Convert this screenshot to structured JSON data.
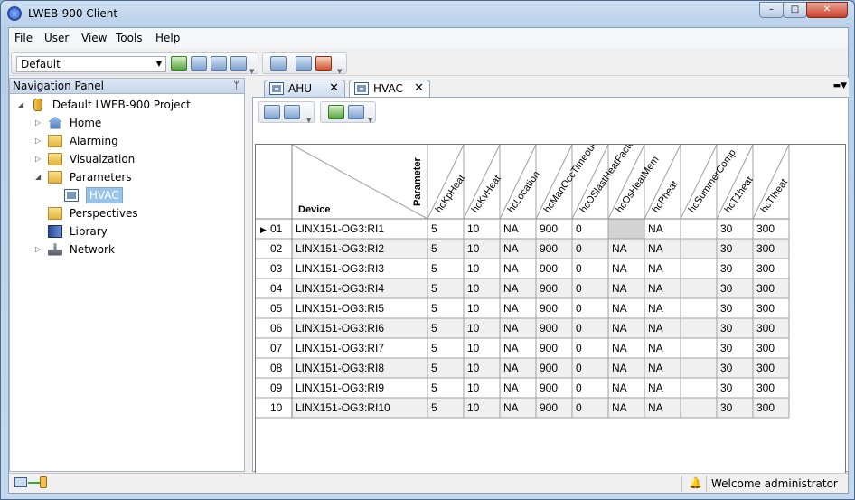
{
  "window": {
    "title": "LWEB-900 Client",
    "minimize": "–",
    "maximize": "□",
    "close": "✕"
  },
  "menu": [
    "File",
    "User",
    "View",
    "Tools",
    "Help"
  ],
  "toolbar": {
    "selector_value": "Default"
  },
  "nav": {
    "header": "Navigation Panel",
    "pin": "ᛘ",
    "project": "Default LWEB-900 Project",
    "items": [
      {
        "label": "Home",
        "icon": "home-icon"
      },
      {
        "label": "Alarming",
        "icon": "folder-icon"
      },
      {
        "label": "Visualzation",
        "icon": "folder-icon"
      },
      {
        "label": "Parameters",
        "icon": "folder-icon"
      },
      {
        "label": "HVAC",
        "icon": "parameter-screen-icon"
      },
      {
        "label": "Perspectives",
        "icon": "folder-icon"
      },
      {
        "label": "Library",
        "icon": "library-book-icon"
      },
      {
        "label": "Network",
        "icon": "network-icon"
      }
    ]
  },
  "tabs": [
    {
      "label": "AHU",
      "active": false
    },
    {
      "label": "HVAC",
      "active": true
    }
  ],
  "grid": {
    "corner_top": "Parameter",
    "corner_bottom": "Device",
    "columns": [
      "hcKpHeat",
      "hcKvHeat",
      "hcLocation",
      "hcManOccTimeout",
      "hcOSlastHeatFactor",
      "hcOsHeatMem",
      "hcPheat",
      "hcSummerComp",
      "hcT1heat",
      "hcTIheat"
    ],
    "current_row_marker": "▶",
    "rows": [
      {
        "num": "01",
        "device": "LINX151-OG3:RI1",
        "cells": [
          "5",
          "10",
          "NA",
          "900",
          "0",
          "",
          "NA",
          "",
          "30",
          "300"
        ]
      },
      {
        "num": "02",
        "device": "LINX151-OG3:RI2",
        "cells": [
          "5",
          "10",
          "NA",
          "900",
          "0",
          "NA",
          "NA",
          "",
          "30",
          "300"
        ]
      },
      {
        "num": "03",
        "device": "LINX151-OG3:RI3",
        "cells": [
          "5",
          "10",
          "NA",
          "900",
          "0",
          "NA",
          "NA",
          "",
          "30",
          "300"
        ]
      },
      {
        "num": "04",
        "device": "LINX151-OG3:RI4",
        "cells": [
          "5",
          "10",
          "NA",
          "900",
          "0",
          "NA",
          "NA",
          "",
          "30",
          "300"
        ]
      },
      {
        "num": "05",
        "device": "LINX151-OG3:RI5",
        "cells": [
          "5",
          "10",
          "NA",
          "900",
          "0",
          "NA",
          "NA",
          "",
          "30",
          "300"
        ]
      },
      {
        "num": "06",
        "device": "LINX151-OG3:RI6",
        "cells": [
          "5",
          "10",
          "NA",
          "900",
          "0",
          "NA",
          "NA",
          "",
          "30",
          "300"
        ]
      },
      {
        "num": "07",
        "device": "LINX151-OG3:RI7",
        "cells": [
          "5",
          "10",
          "NA",
          "900",
          "0",
          "NA",
          "NA",
          "",
          "30",
          "300"
        ]
      },
      {
        "num": "08",
        "device": "LINX151-OG3:RI8",
        "cells": [
          "5",
          "10",
          "NA",
          "900",
          "0",
          "NA",
          "NA",
          "",
          "30",
          "300"
        ]
      },
      {
        "num": "09",
        "device": "LINX151-OG3:RI9",
        "cells": [
          "5",
          "10",
          "NA",
          "900",
          "0",
          "NA",
          "NA",
          "",
          "30",
          "300"
        ]
      },
      {
        "num": "10",
        "device": "LINX151-OG3:RI10",
        "cells": [
          "5",
          "10",
          "NA",
          "900",
          "0",
          "NA",
          "NA",
          "",
          "30",
          "300"
        ]
      }
    ]
  },
  "status": {
    "welcome": "Welcome administrator"
  }
}
